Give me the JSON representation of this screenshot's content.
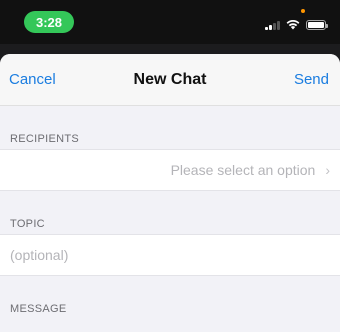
{
  "status_bar": {
    "time": "3:28",
    "time_pill_color": "#34c759",
    "icons": [
      "signal-icon",
      "wifi-icon",
      "battery-icon"
    ]
  },
  "nav": {
    "cancel_label": "Cancel",
    "title": "New Chat",
    "send_label": "Send",
    "accent_color": "#1b7de0"
  },
  "sections": {
    "recipients": {
      "header": "RECIPIENTS",
      "value": "Please select an option",
      "icon": "chevron-right-icon"
    },
    "topic": {
      "header": "TOPIC",
      "placeholder": "(optional)"
    },
    "message": {
      "header": "MESSAGE"
    }
  }
}
